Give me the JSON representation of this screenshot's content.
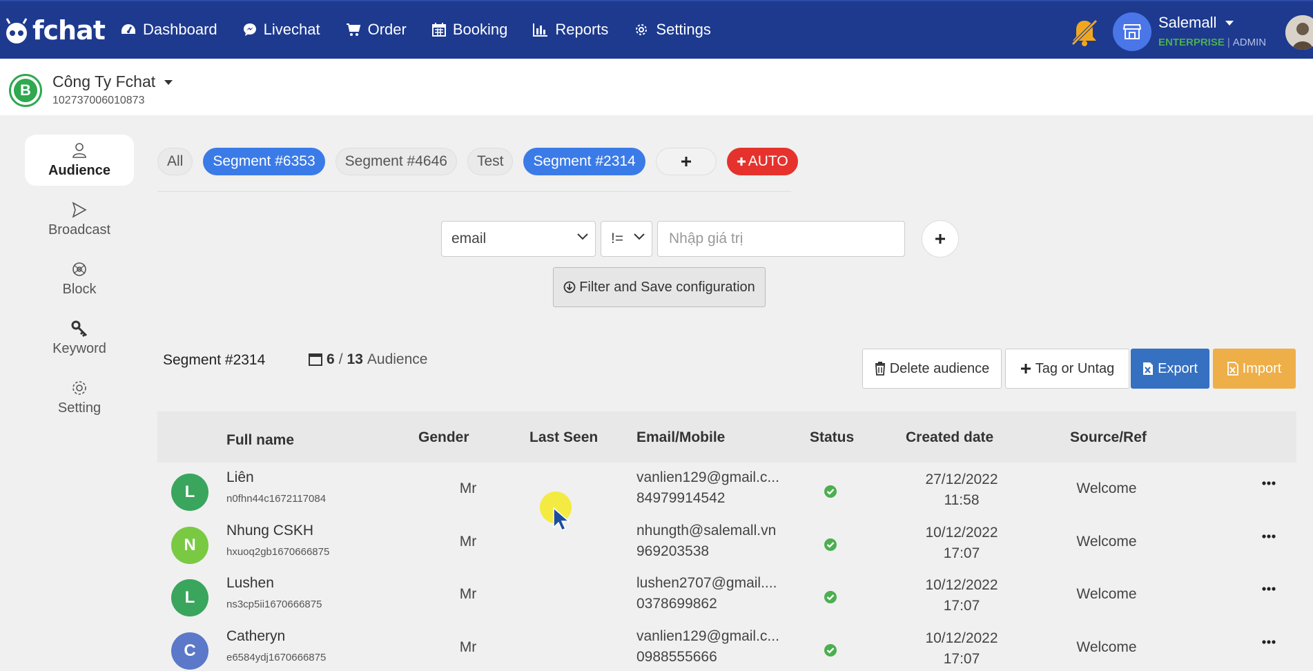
{
  "nav": {
    "logo": "fchat",
    "items": [
      {
        "label": "Dashboard",
        "icon": "dashboard-icon"
      },
      {
        "label": "Livechat",
        "icon": "chat-bubble-icon"
      },
      {
        "label": "Order",
        "icon": "cart-icon"
      },
      {
        "label": "Booking",
        "icon": "calendar-icon"
      },
      {
        "label": "Reports",
        "icon": "bar-chart-icon"
      },
      {
        "label": "Settings",
        "icon": "gear-icon"
      }
    ],
    "account": {
      "name": "Salemall",
      "plan": "ENTERPRISE",
      "role": "ADMIN"
    }
  },
  "company": {
    "name": "Công Ty Fchat",
    "id": "102737006010873",
    "logo_letter": "B"
  },
  "sidebar": {
    "items": [
      {
        "label": "Audience",
        "icon": "user-icon",
        "active": true
      },
      {
        "label": "Broadcast",
        "icon": "send-icon",
        "active": false
      },
      {
        "label": "Block",
        "icon": "block-icon",
        "active": false
      },
      {
        "label": "Keyword",
        "icon": "key-icon",
        "active": false
      },
      {
        "label": "Setting",
        "icon": "gear-icon",
        "active": false
      }
    ]
  },
  "segments": {
    "tabs": [
      "All",
      "Segment #6353",
      "Segment #4646",
      "Test",
      "Segment #2314"
    ],
    "selected": [
      "Segment #6353",
      "Segment #2314"
    ],
    "add_label": "+",
    "auto_label": "AUTO"
  },
  "filter": {
    "field": "email",
    "operator": "!=",
    "value_placeholder": "Nhập giá trị",
    "save_label": "Filter and Save configuration"
  },
  "summary": {
    "segment": "Segment #2314",
    "shown": "6",
    "slash": "/",
    "total": "13",
    "unit": "Audience"
  },
  "actions": {
    "delete": "Delete audience",
    "tag": "Tag or Untag",
    "export": "Export",
    "import": "Import"
  },
  "colors": {
    "nav_bg": "#1d3a8f",
    "accent_blue": "#3b7be8",
    "auto_red": "#e5322d",
    "export_blue": "#3670c0",
    "import_orange": "#eeae48",
    "status_green": "#4caf50"
  },
  "table": {
    "headers": [
      "Full name",
      "Gender",
      "Last Seen",
      "Email/Mobile",
      "Status",
      "Created date",
      "Source/Ref"
    ],
    "rows": [
      {
        "initial": "L",
        "color": "#3aa55d",
        "name": "Liên",
        "id": "n0fhn44c1672117084",
        "gender": "Mr",
        "email": "vanlien129@gmail.c...",
        "mobile": "84979914542",
        "date": "27/12/2022",
        "time": "11:58",
        "source": "Welcome"
      },
      {
        "initial": "N",
        "color": "#7ac943",
        "name": "Nhung CSKH",
        "id": "hxuoq2gb1670666875",
        "gender": "Mr",
        "email": "nhungth@salemall.vn",
        "mobile": "969203538",
        "date": "10/12/2022",
        "time": "17:07",
        "source": "Welcome"
      },
      {
        "initial": "L",
        "color": "#3aa55d",
        "name": "Lushen",
        "id": "ns3cp5ii1670666875",
        "gender": "Mr",
        "email": "lushen2707@gmail....",
        "mobile": "0378699862",
        "date": "10/12/2022",
        "time": "17:07",
        "source": "Welcome"
      },
      {
        "initial": "C",
        "color": "#5b78c9",
        "name": "Catheryn",
        "id": "e6584ydj1670666875",
        "gender": "Mr",
        "email": "vanlien129@gmail.c...",
        "mobile": "0988555666",
        "date": "10/12/2022",
        "time": "17:07",
        "source": "Welcome"
      }
    ]
  }
}
